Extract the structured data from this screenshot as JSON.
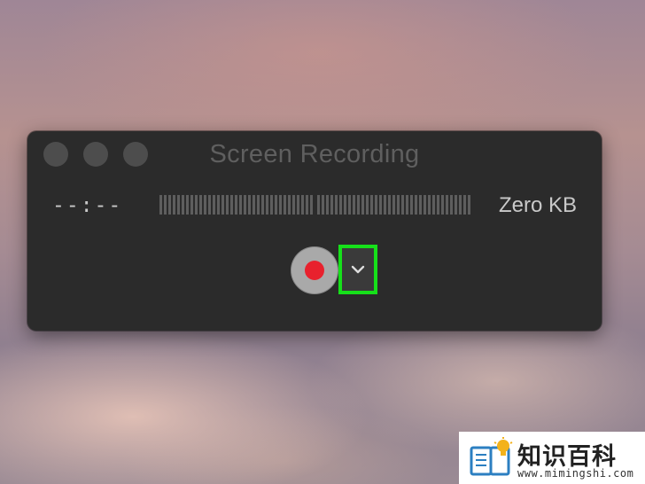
{
  "window": {
    "title": "Screen Recording",
    "elapsed_time": "--:--",
    "file_size": "Zero KB",
    "record_button_label": "Record",
    "options_button_label": "Options"
  },
  "audio_meter": {
    "level": 0,
    "segments": 70,
    "gaps_after": [
      35
    ]
  },
  "watermark": {
    "name": "知识百科",
    "url": "www.mimingshi.com"
  },
  "colors": {
    "window_bg": "#2b2b2b",
    "record_dot": "#e8212d",
    "highlight_box": "#16e01a",
    "record_button": "#a9a9a9"
  },
  "icons": {
    "options": "chevron-down-icon",
    "watermark": "book-lightbulb-icon"
  }
}
